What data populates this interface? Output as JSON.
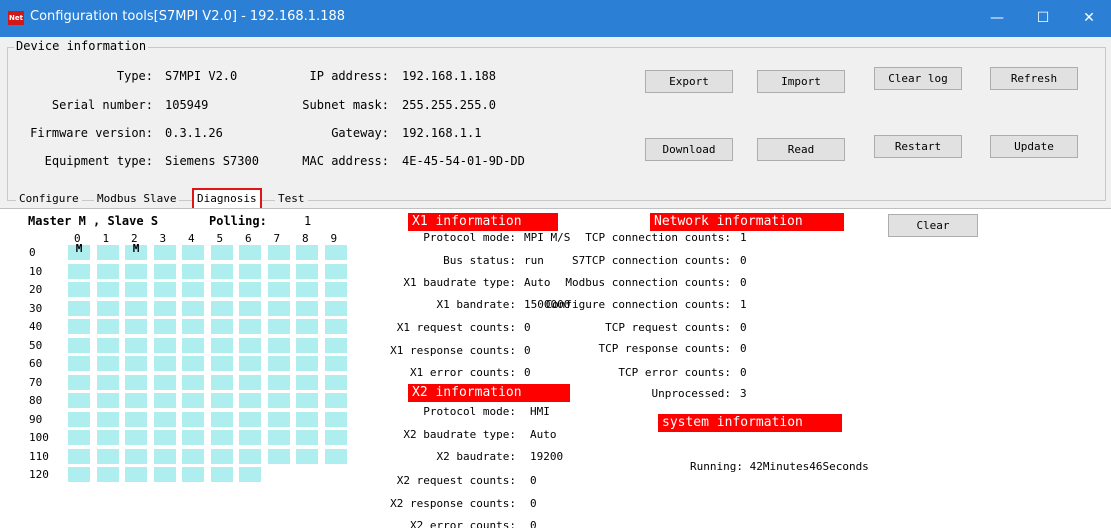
{
  "window": {
    "icon_text": "Net",
    "title": "Configuration tools[S7MPI V2.0] - 192.168.1.188",
    "minimize": "—",
    "maximize": "☐",
    "close": "✕"
  },
  "device": {
    "legend": "Device information",
    "type_label": "Type:",
    "type": "S7MPI V2.0",
    "serial_label": "Serial number:",
    "serial": "105949",
    "firmware_label": "Firmware version:",
    "firmware": "0.3.1.26",
    "equipment_label": "Equipment type:",
    "equipment": "Siemens S7300",
    "ip_label": "IP address:",
    "ip": "192.168.1.188",
    "subnet_label": "Subnet mask:",
    "subnet": "255.255.255.0",
    "gateway_label": "Gateway:",
    "gateway": "192.168.1.1",
    "mac_label": "MAC address:",
    "mac": "4E-45-54-01-9D-DD"
  },
  "buttons": {
    "export": "Export",
    "import": "Import",
    "clear_log": "Clear log",
    "refresh": "Refresh",
    "download": "Download",
    "read": "Read",
    "restart": "Restart",
    "update": "Update",
    "clear": "Clear"
  },
  "tabs": [
    {
      "label": "Configure"
    },
    {
      "label": "Modbus Slave"
    },
    {
      "label": "Diagnosis"
    },
    {
      "label": "Test"
    }
  ],
  "grid": {
    "legend_a": "Master M , Slave S",
    "polling_label": "Polling:",
    "polling_value": "1",
    "col_headers": [
      "0",
      "1",
      "2",
      "3",
      "4",
      "5",
      "6",
      "7",
      "8",
      "9"
    ],
    "row_headers": [
      "0",
      "10",
      "20",
      "30",
      "40",
      "50",
      "60",
      "70",
      "80",
      "90",
      "100",
      "110",
      "120"
    ],
    "marks": [
      {
        "row": 0,
        "col": 0,
        "text": "M"
      },
      {
        "row": 0,
        "col": 2,
        "text": "M"
      }
    ]
  },
  "x1": {
    "header": "X1 information",
    "rows": [
      {
        "label": "Protocol mode:",
        "value": "MPI M/S"
      },
      {
        "label": "Bus status:",
        "value": "run"
      },
      {
        "label": "X1 baudrate type:",
        "value": "Auto"
      },
      {
        "label": "X1 bandrate:",
        "value": "1500000"
      },
      {
        "label": "X1 request counts:",
        "value": "0"
      },
      {
        "label": "X1 response counts:",
        "value": "0"
      },
      {
        "label": "X1 error counts:",
        "value": "0"
      }
    ]
  },
  "x2": {
    "header": "X2 information",
    "rows": [
      {
        "label": "Protocol mode:",
        "value": "HMI"
      },
      {
        "label": "X2 baudrate type:",
        "value": "Auto"
      },
      {
        "label": "X2 baudrate:",
        "value": "19200"
      },
      {
        "label": "X2 request counts:",
        "value": "0"
      },
      {
        "label": "X2 response counts:",
        "value": "0"
      },
      {
        "label": "X2 error counts:",
        "value": "0"
      }
    ]
  },
  "network": {
    "header": "Network information",
    "rows": [
      {
        "label": "TCP connection counts:",
        "value": "1"
      },
      {
        "label": "S7TCP connection counts:",
        "value": "0"
      },
      {
        "label": "Modbus connection counts:",
        "value": "0"
      },
      {
        "label": "Configure connection counts:",
        "value": "1"
      },
      {
        "label": "TCP request counts:",
        "value": "0"
      },
      {
        "label": "TCP response counts:",
        "value": "0"
      },
      {
        "label": "TCP error counts:",
        "value": "0"
      },
      {
        "label": "Unprocessed:",
        "value": "3"
      }
    ]
  },
  "system": {
    "header": "system information",
    "running": "Running: 42Minutes46Seconds"
  }
}
